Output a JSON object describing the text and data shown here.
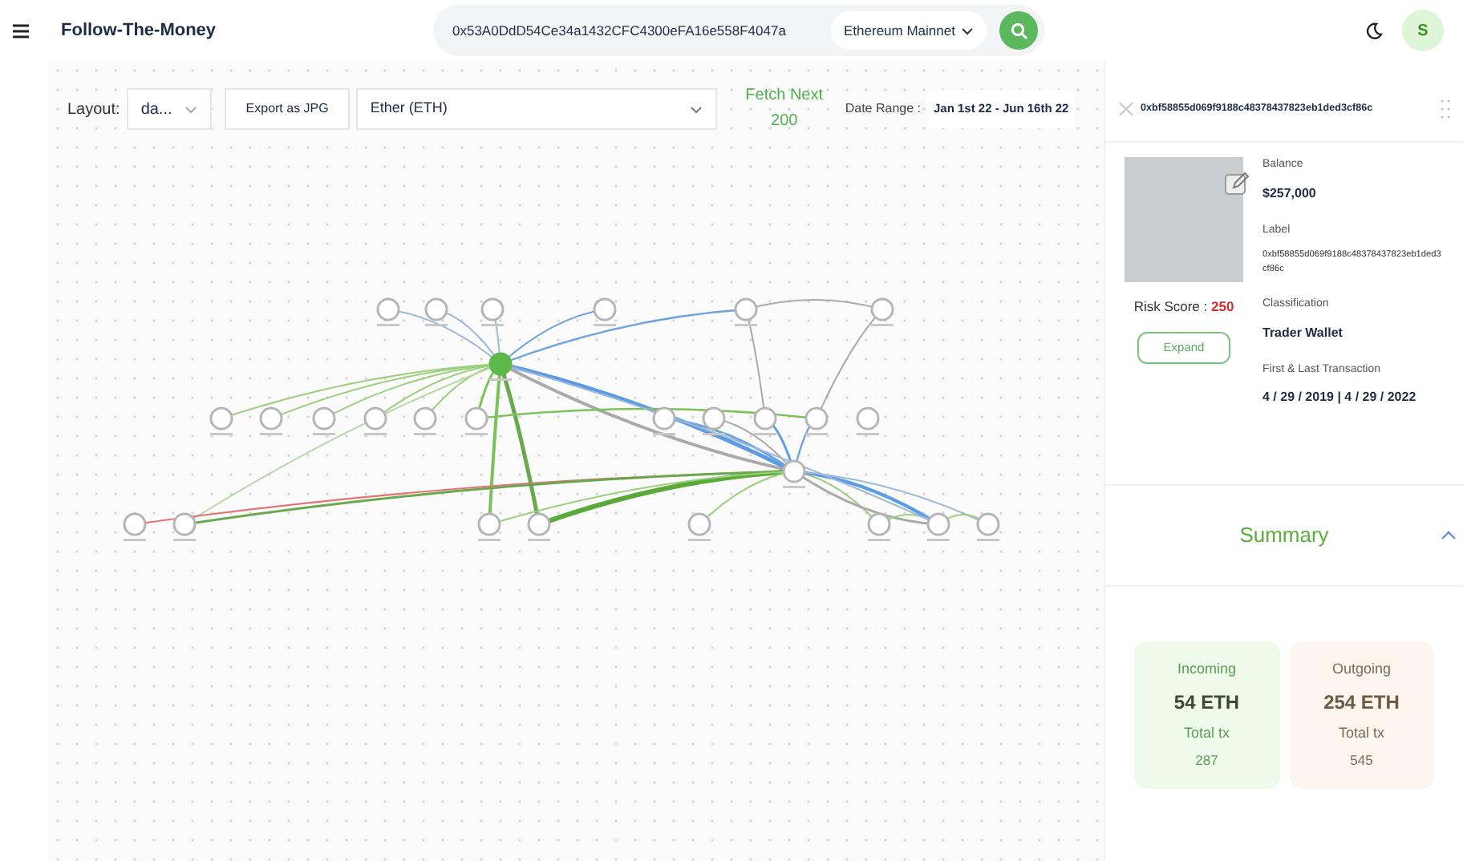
{
  "header": {
    "app_title": "Follow-The-Money",
    "search": {
      "value": "0x53A0DdD54Ce34a1432CFC4300eFA16e558F4047a"
    },
    "network": "Ethereum Mainnet",
    "avatar": "S"
  },
  "toolbar": {
    "layout_label": "Layout:",
    "layout_value": "da...",
    "export_button": "Export as JPG",
    "token": "Ether (ETH)",
    "fetch_next": "Fetch Next",
    "fetch_count": "200",
    "date_label": "Date Range :",
    "date_value": "Jan 1st 22 - Jun 16th 22"
  },
  "panel": {
    "address": "0xbf58855d069f9188c48378437823eb1ded3cf86c",
    "risk_label": "Risk Score : ",
    "risk_value": "250",
    "expand_button": "Expand",
    "fields": [
      {
        "label": "Balance",
        "value": "$257,000",
        "kind": "bold"
      },
      {
        "label": "Label",
        "value": "0xbf58855d069f9188c48378437823eb1ded3cf86c",
        "kind": "small"
      },
      {
        "label": "Classification",
        "value": "Trader Wallet",
        "kind": "bold"
      },
      {
        "label": "First & Last Transaction",
        "value": "4 / 29 / 2019 | 4 / 29 / 2022",
        "kind": "bold"
      }
    ],
    "summary": {
      "title": "Summary",
      "expanded": true,
      "cards": [
        {
          "kind": "incoming",
          "title": "Incoming",
          "amount": "54 ETH",
          "tx_label": "Total tx",
          "tx_count": "287"
        },
        {
          "kind": "outgoing",
          "title": "Outgoing",
          "amount": "254 ETH",
          "tx_label": "Total tx",
          "tx_count": "545"
        }
      ]
    }
  }
}
